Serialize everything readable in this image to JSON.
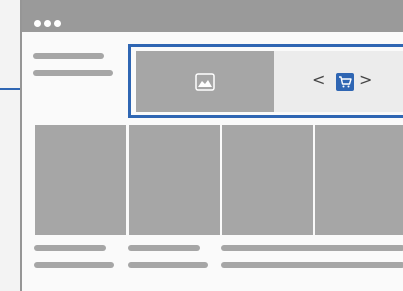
{
  "window": {
    "controls": [
      "close-dot",
      "minimize-dot",
      "maximize-dot"
    ]
  },
  "hero": {
    "image_icon": "image-icon",
    "carousel_icon": "shopping-cart-icon",
    "prev_arrow": "<",
    "next_arrow": ">"
  },
  "colors": {
    "accent": "#2f66b3",
    "placeholder": "#a6a6a6",
    "titlebar": "#9a9a9a"
  },
  "grid": {
    "tile_count": 4
  }
}
